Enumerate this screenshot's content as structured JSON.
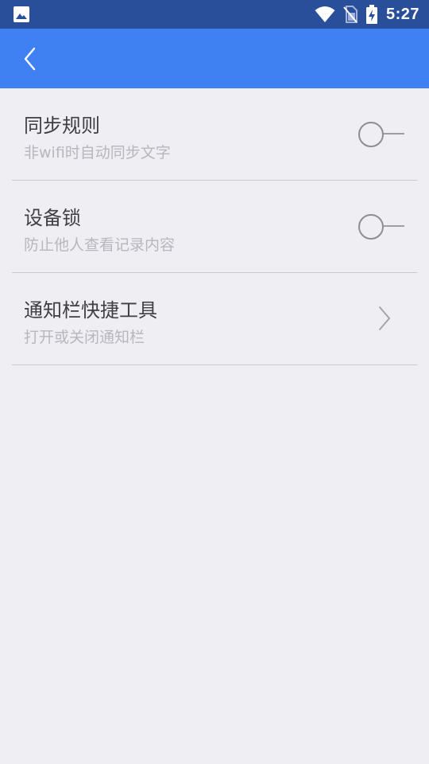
{
  "status_bar": {
    "time": "5:27",
    "left_icon": "image-icon",
    "icons": [
      "wifi-icon",
      "no-sim-icon",
      "battery-charging-icon"
    ],
    "background": "#2a4f9a"
  },
  "toolbar": {
    "back_icon": "chevron-left-icon",
    "background": "#3f81f3"
  },
  "settings": [
    {
      "title": "同步规则",
      "subtitle": "非wifi时自动同步文字",
      "control": "toggle",
      "checked": false
    },
    {
      "title": "设备锁",
      "subtitle": "防止他人查看记录内容",
      "control": "toggle",
      "checked": false
    },
    {
      "title": "通知栏快捷工具",
      "subtitle": "打开或关闭通知栏",
      "control": "chevron-right-icon"
    }
  ]
}
